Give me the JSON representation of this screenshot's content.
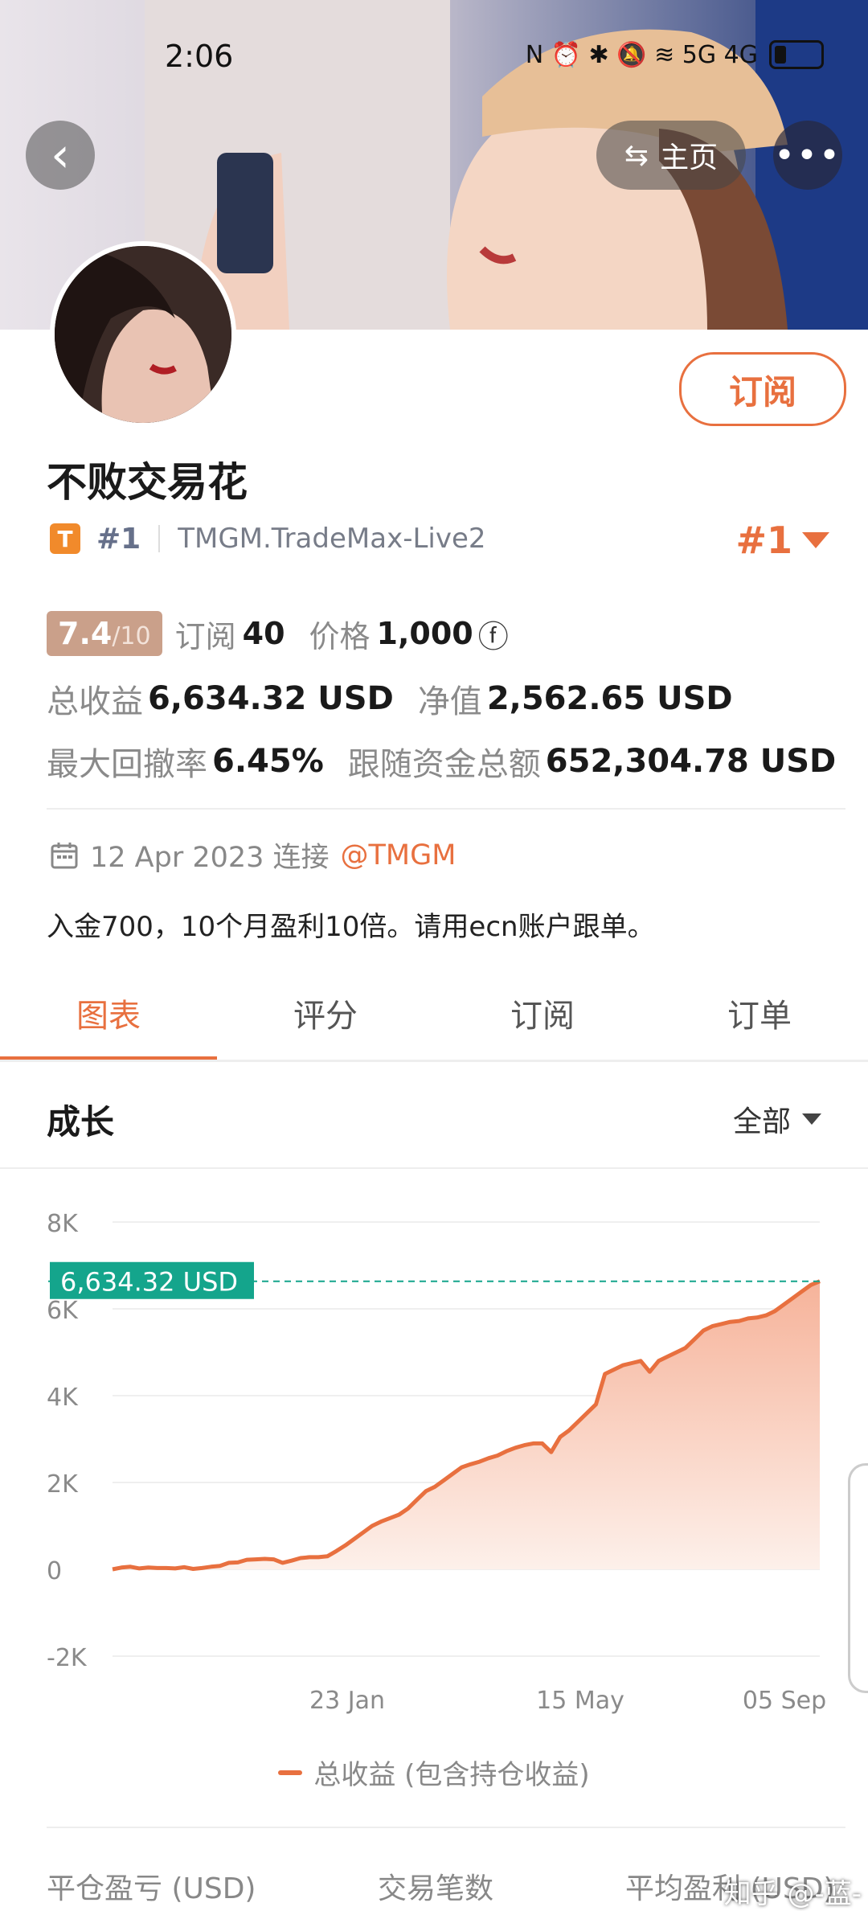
{
  "status_bar": {
    "time": "2:06",
    "network_icons": "N ⏰ ✱ 🔕 ≋ 5G 4G"
  },
  "nav": {
    "home_label": "主页"
  },
  "profile": {
    "name": "不败交易花",
    "subscribe_label": "订阅",
    "tier_badge": "T",
    "rank": "#1",
    "server": "TMGM.TradeMax-Live2",
    "rank_right": "#1"
  },
  "stats": {
    "score": "7.4",
    "score_max": "/10",
    "subscribers_label": "订阅",
    "subscribers_value": "40",
    "price_label": "价格",
    "price_value": "1,000",
    "price_icon": "ⓕ",
    "total_profit_label": "总收益",
    "total_profit_value": "6,634.32 USD",
    "equity_label": "净值",
    "equity_value": "2,562.65 USD",
    "max_drawdown_label": "最大回撤率",
    "max_drawdown_value": "6.45%",
    "followers_funds_label": "跟随资金总额",
    "followers_funds_value": "652,304.78 USD"
  },
  "info": {
    "date": "12 Apr 2023 连接",
    "broker_handle": "@TMGM",
    "description": "入金700，10个月盈利10倍。请用ecn账户跟单。"
  },
  "tabs": [
    {
      "label": "图表",
      "active": true
    },
    {
      "label": "评分",
      "active": false
    },
    {
      "label": "订阅",
      "active": false
    },
    {
      "label": "订单",
      "active": false
    }
  ],
  "section": {
    "title": "成长",
    "range": "全部"
  },
  "chart_data": {
    "type": "area",
    "ylabel": "",
    "xlabel": "",
    "ylim": [
      -2000,
      8000
    ],
    "y_ticks": [
      "8K",
      "6K",
      "4K",
      "2K",
      "0",
      "-2K"
    ],
    "x_ticks": [
      "23 Jan",
      "15 May",
      "05 Sep"
    ],
    "current_value_label": "6,634.32 USD",
    "series": [
      {
        "name": "总收益 (包含持仓收益)",
        "values": [
          0,
          40,
          60,
          20,
          40,
          30,
          30,
          20,
          50,
          10,
          30,
          60,
          80,
          150,
          160,
          220,
          230,
          240,
          230,
          150,
          200,
          260,
          280,
          280,
          300,
          420,
          550,
          700,
          850,
          1000,
          1100,
          1180,
          1260,
          1400,
          1600,
          1800,
          1900,
          2050,
          2200,
          2350,
          2420,
          2480,
          2560,
          2620,
          2720,
          2800,
          2860,
          2900,
          2900,
          2700,
          3050,
          3200,
          3400,
          3600,
          3800,
          4500,
          4600,
          4700,
          4750,
          4800,
          4550,
          4800,
          4900,
          5000,
          5100,
          5300,
          5500,
          5600,
          5650,
          5700,
          5720,
          5780,
          5800,
          5850,
          5950,
          6100,
          6250,
          6400,
          6550,
          6634.32
        ]
      }
    ],
    "colors": {
      "line": "#e8703f",
      "fill_top": "#f6b39a",
      "fill_bottom": "#fbe9e1",
      "marker": "#14a58c"
    }
  },
  "bottom_stats": {
    "closed_pl_label": "平仓盈亏 (USD)",
    "trades_label": "交易笔数",
    "avg_profit_label": "平均盈利 (USD)"
  },
  "watermark": "知乎 @-蓝-"
}
